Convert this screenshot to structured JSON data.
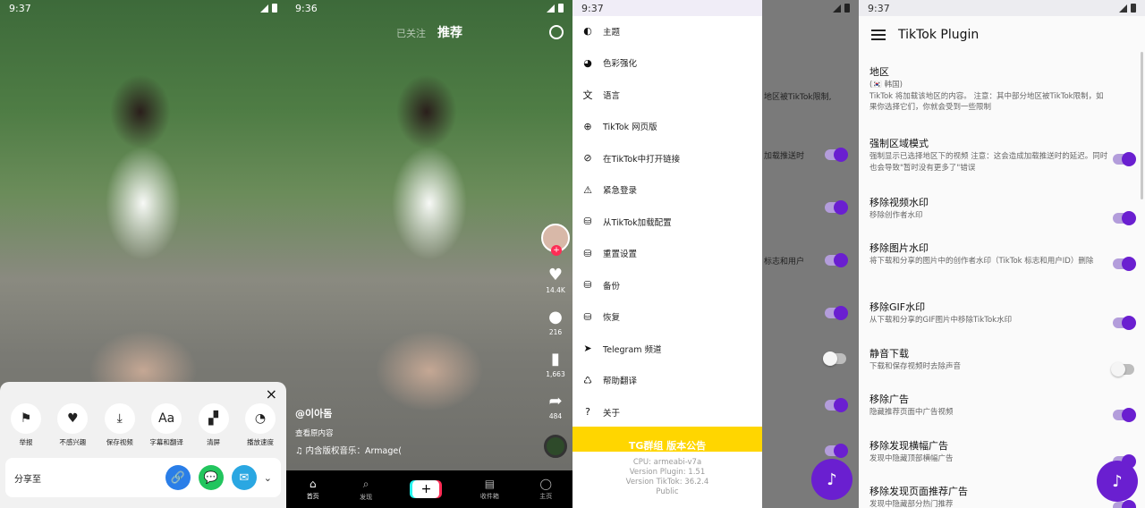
{
  "panel1": {
    "status_time": "9:37",
    "close_glyph": "×",
    "actions": [
      {
        "label": "举报",
        "icon": "flag-icon",
        "glyph": "⚑"
      },
      {
        "label": "不感兴趣",
        "icon": "broken-heart-icon",
        "glyph": "♥"
      },
      {
        "label": "保存视频",
        "icon": "download-icon",
        "glyph": "⤓"
      },
      {
        "label": "字幕和翻译",
        "icon": "caption-icon",
        "glyph": "Aa"
      },
      {
        "label": "清屏",
        "icon": "clear-screen-icon",
        "glyph": "▞"
      },
      {
        "label": "播放速度",
        "icon": "speed-icon",
        "glyph": "◔"
      }
    ],
    "share_label": "分享至",
    "share_targets": [
      {
        "icon": "link-icon",
        "glyph": "🔗",
        "color": "#2a7ee8"
      },
      {
        "icon": "chat-icon",
        "glyph": "💬",
        "color": "#22c55e"
      },
      {
        "icon": "email-icon",
        "glyph": "✉",
        "color": "#2aa7e2"
      }
    ],
    "expand_glyph": "⌄"
  },
  "panel2": {
    "status_time": "9:36",
    "tab_muted": "已关注",
    "tab_active": "推荐",
    "likes": "14.4K",
    "comments": "216",
    "saves": "1,663",
    "shares": "484",
    "username": "@이아돔",
    "caption_line": "查看原内容",
    "music": "♫ 内含版权音乐：Armage(",
    "nav": [
      {
        "label": "首页",
        "glyph": "⌂",
        "active": true
      },
      {
        "label": "发现",
        "glyph": "⌕",
        "active": false
      },
      {
        "label": "收件箱",
        "glyph": "▤",
        "active": false
      },
      {
        "label": "主页",
        "glyph": "◯",
        "active": false
      }
    ],
    "plus_glyph": "+"
  },
  "panel3": {
    "status_time": "9:37",
    "menu": [
      {
        "label": "主题",
        "icon": "theme-icon",
        "glyph": "◐"
      },
      {
        "label": "色彩强化",
        "icon": "palette-icon",
        "glyph": "◕"
      },
      {
        "label": "语言",
        "icon": "translate-icon",
        "glyph": "文"
      },
      {
        "label": "TikTok 网页版",
        "icon": "globe-icon",
        "glyph": "⊕"
      },
      {
        "label": "在TikTok中打开链接",
        "icon": "link-icon",
        "glyph": "⊘"
      },
      {
        "label": "紧急登录",
        "icon": "alarm-icon",
        "glyph": "⚠"
      },
      {
        "label": "从TikTok加载配置",
        "icon": "database-settings-icon",
        "glyph": "⛁"
      },
      {
        "label": "重置设置",
        "icon": "database-remove-icon",
        "glyph": "⛁"
      },
      {
        "label": "备份",
        "icon": "database-upload-icon",
        "glyph": "⛁"
      },
      {
        "label": "恢复",
        "icon": "database-restore-icon",
        "glyph": "⛁"
      },
      {
        "label": "Telegram 频道",
        "icon": "telegram-icon",
        "glyph": "➤"
      },
      {
        "label": "帮助翻译",
        "icon": "translate-help-icon",
        "glyph": "♺"
      },
      {
        "label": "关于",
        "icon": "help-icon",
        "glyph": "?"
      }
    ],
    "banner": "TG群组 版本公告",
    "cpu": "CPU: armeabi-v7a",
    "version_plugin": "Version Plugin: 1.51",
    "version_tiktok": "Version TikTok: 36.2.4",
    "build": "Public",
    "behind_texts": [
      "地区被TikTok限制,",
      "加载推送时",
      "标志和用户"
    ]
  },
  "panel4": {
    "status_time": "9:37",
    "title": "TikTok Plugin",
    "prefs": [
      {
        "title": "地区",
        "sub": "(🇰🇷 韩国)\nTikTok 将加载该地区的内容。 注意：其中部分地区被TikTok限制，如果你选择它们，你就会受到一些限制",
        "toggle": null
      },
      {
        "title": "强制区域模式",
        "sub": "强制显示已选择地区下的视频 注意：这会造成加载推送时的延迟。同时也会导致\"暂时没有更多了\"错误",
        "toggle": true
      },
      {
        "title": "移除视频水印",
        "sub": "移除创作者水印",
        "toggle": true
      },
      {
        "title": "移除图片水印",
        "sub": "将下载和分享的图片中的创作者水印（TikTok 标志和用户ID）删除",
        "toggle": true
      },
      {
        "title": "移除GIF水印",
        "sub": "从下载和分享的GIF图片中移除TikTok水印",
        "toggle": true
      },
      {
        "title": "静音下载",
        "sub": "下载和保存视频时去除声音",
        "toggle": false
      },
      {
        "title": "移除广告",
        "sub": "隐藏推荐页面中广告视频",
        "toggle": true
      },
      {
        "title": "移除发现横幅广告",
        "sub": "发现中隐藏顶部横幅广告",
        "toggle": true
      },
      {
        "title": "移除发现页面推荐广告",
        "sub": "发现中隐藏部分热门推荐",
        "toggle": true
      }
    ]
  },
  "colors": {
    "accent": "#6a1fd0",
    "banner": "#ffd600",
    "tiktok_red": "#fe2c55",
    "tiktok_cyan": "#25f4ee"
  }
}
